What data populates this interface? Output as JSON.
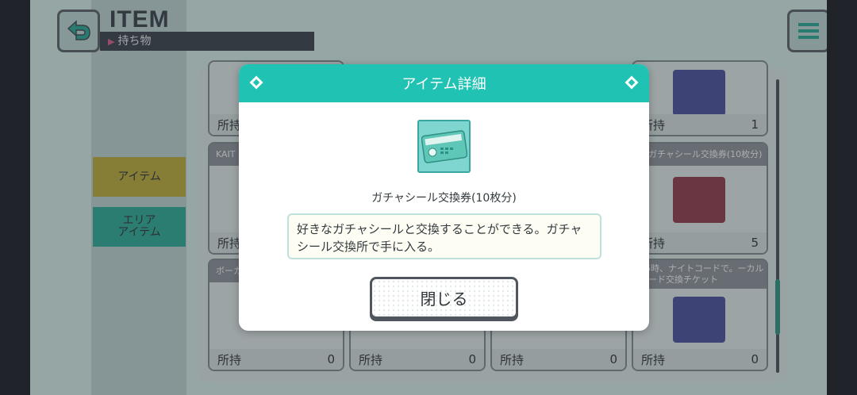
{
  "header": {
    "title": "ITEM",
    "subtitle": "持ち物"
  },
  "sidebar": {
    "tabs": [
      {
        "label": "アイテム"
      },
      {
        "label": "エリア\nアイテム"
      }
    ]
  },
  "cards": [
    {
      "head": "",
      "owned_label": "所持",
      "count": ""
    },
    {
      "head": "",
      "owned_label": "所持",
      "count": "1"
    },
    {
      "head": "KAIT",
      "owned_label": "所持",
      "count": ""
    },
    {
      "head": "定ガチャシール交換券(10枚分)",
      "owned_label": "所持",
      "count": "5"
    },
    {
      "head": "ボーカ",
      "owned_label": "所持",
      "count": "0"
    },
    {
      "head": "",
      "owned_label": "所持",
      "count": "0"
    },
    {
      "head": "",
      "owned_label": "所持",
      "count": "0"
    },
    {
      "head": "25時、ナイトコードで。ーカルカード交換チケット",
      "owned_label": "所持",
      "count": "0"
    }
  ],
  "modal": {
    "title": "アイテム詳細",
    "item_name": "ガチャシール交換券(10枚分)",
    "description": "好きなガチャシールと交換することができる。ガチャシール交換所で手に入る。",
    "close_label": "閉じる",
    "icon": "ticket-icon"
  },
  "colors": {
    "accent": "#20c2b4",
    "tab_items": "#b9a839",
    "tab_area": "#2fa893"
  }
}
